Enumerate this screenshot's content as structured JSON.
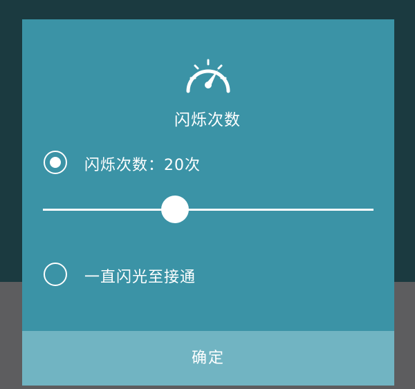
{
  "dialog": {
    "icon": "speedometer-icon",
    "title": "闪烁次数",
    "options": [
      {
        "label": "闪烁次数：20次",
        "selected": true
      },
      {
        "label": "一直闪光至接通",
        "selected": false
      }
    ],
    "slider": {
      "value_fraction": 0.4
    },
    "confirm_label": "确定"
  },
  "colors": {
    "dialog_bg": "#3b93a6",
    "confirm_bar_bg": "#71b4c2",
    "backdrop_top": "#1b3a40",
    "backdrop_bottom": "#5d5d5f",
    "foreground": "#ffffff"
  }
}
